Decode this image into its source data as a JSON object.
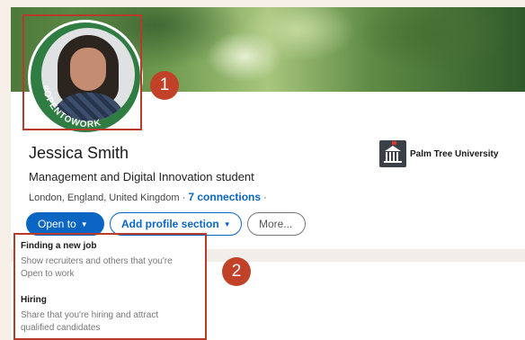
{
  "profile": {
    "name": "Jessica Smith",
    "headline": "Management and Digital Innovation student",
    "location": "London, England, United Kingdom",
    "separator": "·",
    "connections_label": "7 connections",
    "open_to_work_frame_text": "#OPENTOWORK"
  },
  "education": {
    "school_name": "Palm Tree University"
  },
  "actions": {
    "open_to_label": "Open to",
    "add_section_label": "Add profile section",
    "more_label": "More..."
  },
  "annotations": {
    "badge_1": "1",
    "badge_2": "2"
  },
  "open_to_menu": {
    "items": [
      {
        "title": "Finding a new job",
        "desc_line1": "Show recruiters and others that you're",
        "desc_line2": "Open to work"
      },
      {
        "title": "Hiring",
        "desc_line1": "Share that you're hiring and attract",
        "desc_line2": "qualified candidates"
      }
    ]
  },
  "colors": {
    "accent_blue": "#0a66c2",
    "highlight_red": "#b83a2a",
    "badge_red": "#c24229",
    "open_to_work_green": "#2f7d43"
  }
}
